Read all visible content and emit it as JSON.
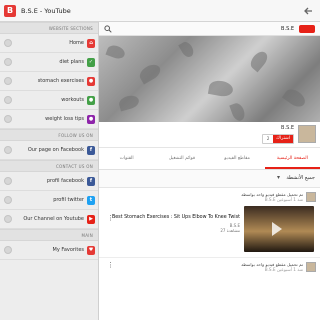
{
  "app": {
    "title": "B.S.E - YouTube",
    "icon_letter": "B"
  },
  "drawer": {
    "sections": [
      {
        "label": "WEBSITE SECTIONS",
        "items": [
          {
            "label": "Home",
            "icon": "home-icon",
            "color": "#e53935"
          },
          {
            "label": "diet plans",
            "icon": "diet-icon",
            "color": "#43a047"
          },
          {
            "label": "stomach exercises",
            "icon": "exercise-icon",
            "color": "#e53935"
          },
          {
            "label": "workouts",
            "icon": "workout-icon",
            "color": "#43a047"
          },
          {
            "label": "weight loss tips",
            "icon": "tips-icon",
            "color": "#8e24aa"
          }
        ]
      },
      {
        "label": "FOLLOW US ON",
        "items": [
          {
            "label": "Our page on Facebook",
            "icon": "facebook-icon",
            "color": "#3b5998"
          }
        ]
      },
      {
        "label": "CONTACT US ON",
        "items": [
          {
            "label": "profil facebook",
            "icon": "facebook-icon",
            "color": "#3b5998"
          },
          {
            "label": "profil twitter",
            "icon": "twitter-icon",
            "color": "#1da1f2"
          },
          {
            "label": "Our Channel on Youtube",
            "icon": "youtube-icon",
            "color": "#e62117"
          }
        ]
      },
      {
        "label": "MAIN",
        "items": [
          {
            "label": "My Favorites",
            "icon": "favorite-icon",
            "color": "#e53935"
          }
        ]
      }
    ]
  },
  "main": {
    "search_icon": "search-icon",
    "yt_title": "B.S.E",
    "channel": {
      "name": "B.S.E",
      "sub_label": "اشتراك",
      "sub_count": "2"
    },
    "tabs": [
      {
        "label": "الصفحة الرئيسية",
        "active": true
      },
      {
        "label": "مقاطع الفيديو",
        "active": false
      },
      {
        "label": "قوائم التشغيل",
        "active": false
      },
      {
        "label": "القنوات",
        "active": false
      }
    ],
    "filter_label": "جميع الأنشطة",
    "posts": [
      {
        "header": "تم تحميل مقطع فيديو واحد بواسطة",
        "time": "B.S.E منذ 1 أسبوعين"
      },
      {
        "header": "تم تحميل مقطع فيديو واحد بواسطة",
        "time": "B.S.E منذ 1 أسبوعين"
      }
    ],
    "video": {
      "title": "Best Stomach Exercises : Sit Ups Elbow To Knee Twist",
      "channel": "B.S.E",
      "views": "27 مشاهدة"
    }
  },
  "colors": {
    "accent": "#e62117",
    "appbar": "#f7f7f7",
    "drawer_bg": "#ededed"
  }
}
